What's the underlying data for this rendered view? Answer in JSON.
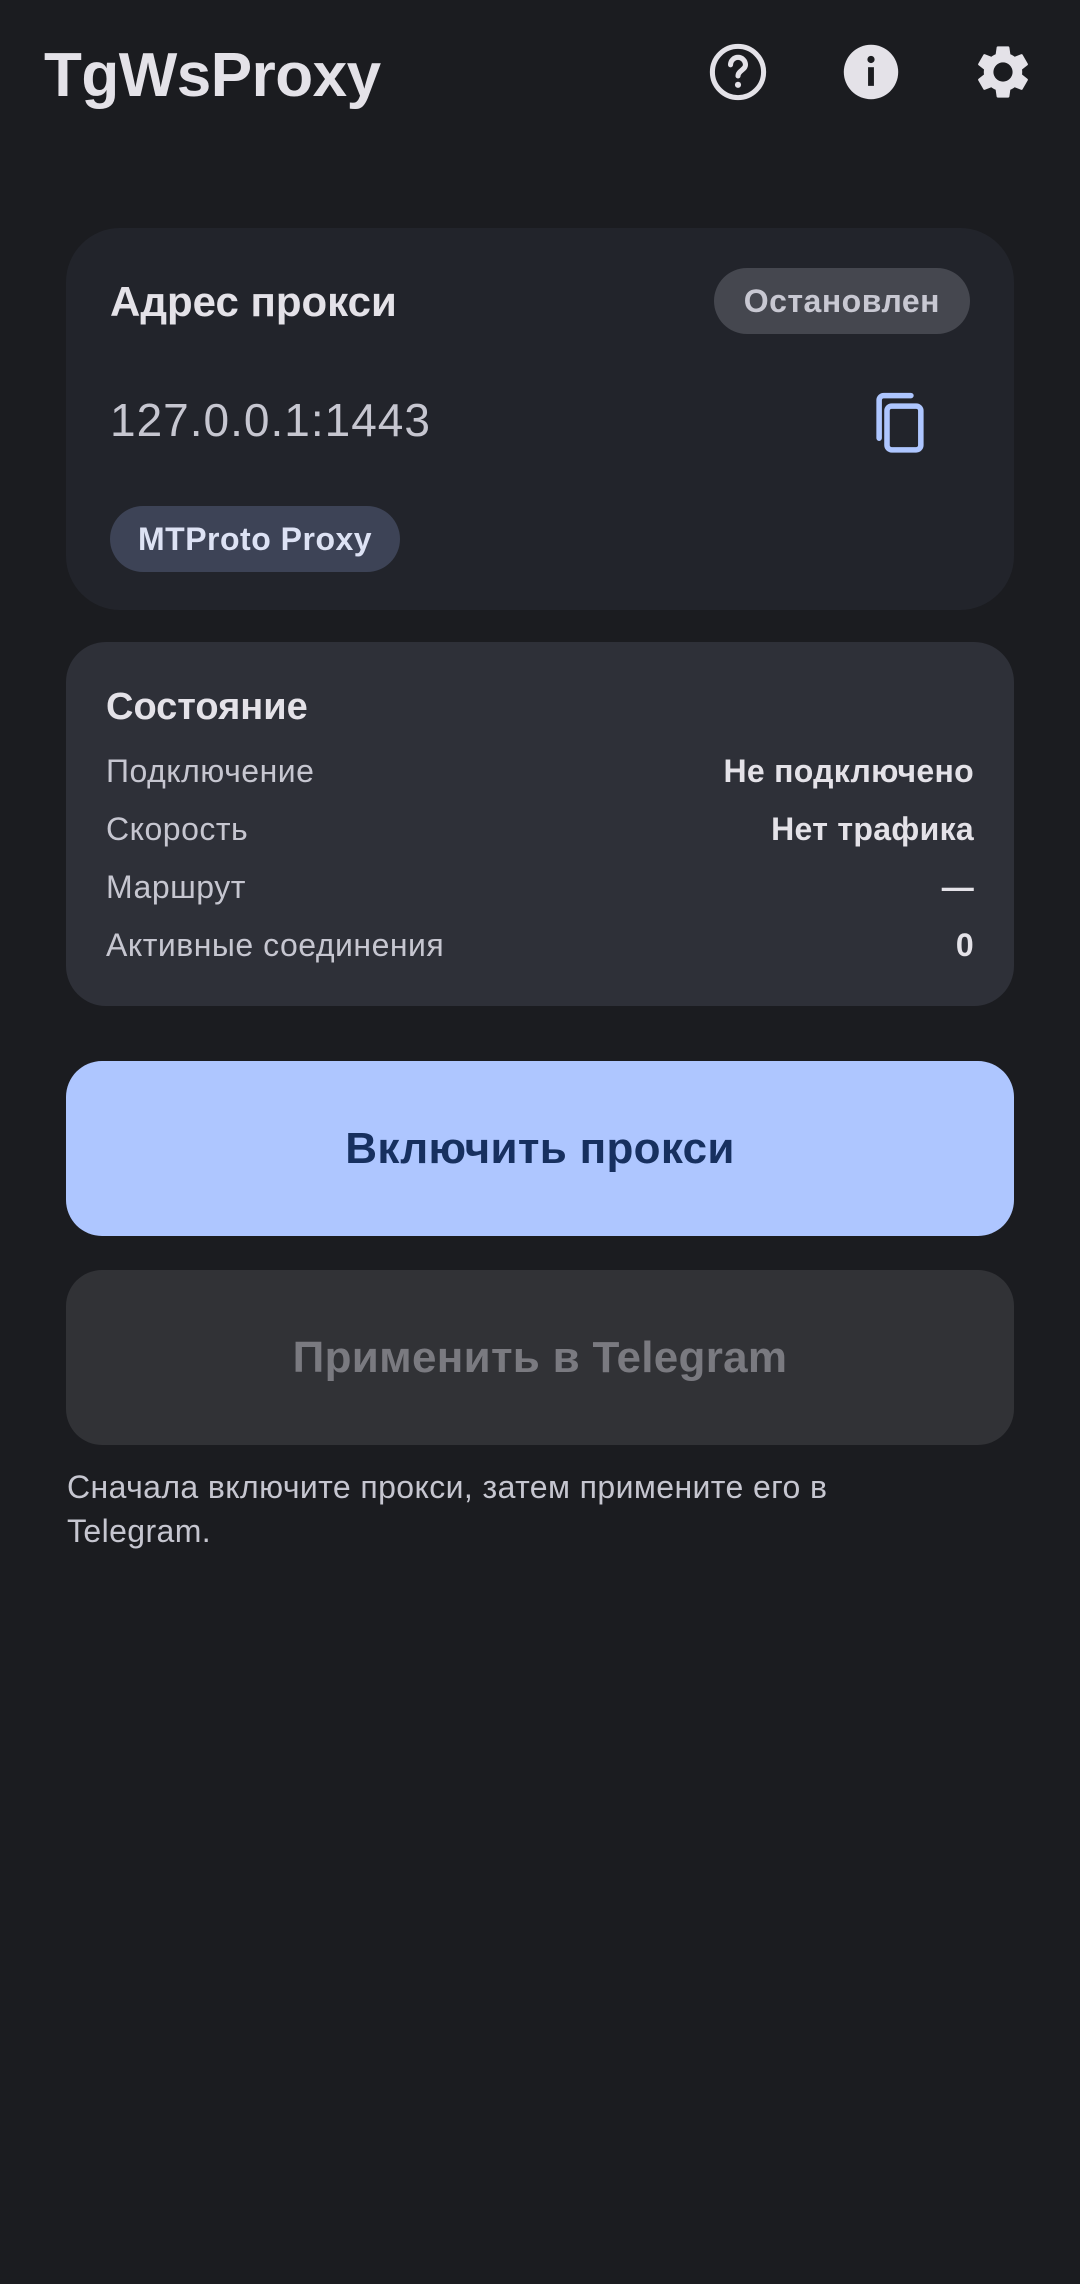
{
  "header": {
    "title": "TgWsProxy",
    "icons": [
      "help-circle-icon",
      "info-icon",
      "gear-icon"
    ]
  },
  "proxy_card": {
    "title": "Адрес прокси",
    "status": "Остановлен",
    "address": "127.0.0.1:1443",
    "copy_icon": "copy-icon",
    "type": "MTProto Proxy"
  },
  "state_card": {
    "title": "Состояние",
    "rows": [
      {
        "label": "Подключение",
        "value": "Не подключено"
      },
      {
        "label": "Скорость",
        "value": "Нет трафика"
      },
      {
        "label": "Маршрут",
        "value": "—"
      },
      {
        "label": "Активные соединения",
        "value": "0"
      }
    ]
  },
  "actions": {
    "enable_label": "Включить прокси",
    "apply_label": "Применить в Telegram",
    "hint": "Сначала включите прокси, затем примените его в Telegram."
  },
  "colors": {
    "background": "#1b1c20",
    "primary": "#aec6ff",
    "on_primary": "#17305f"
  }
}
